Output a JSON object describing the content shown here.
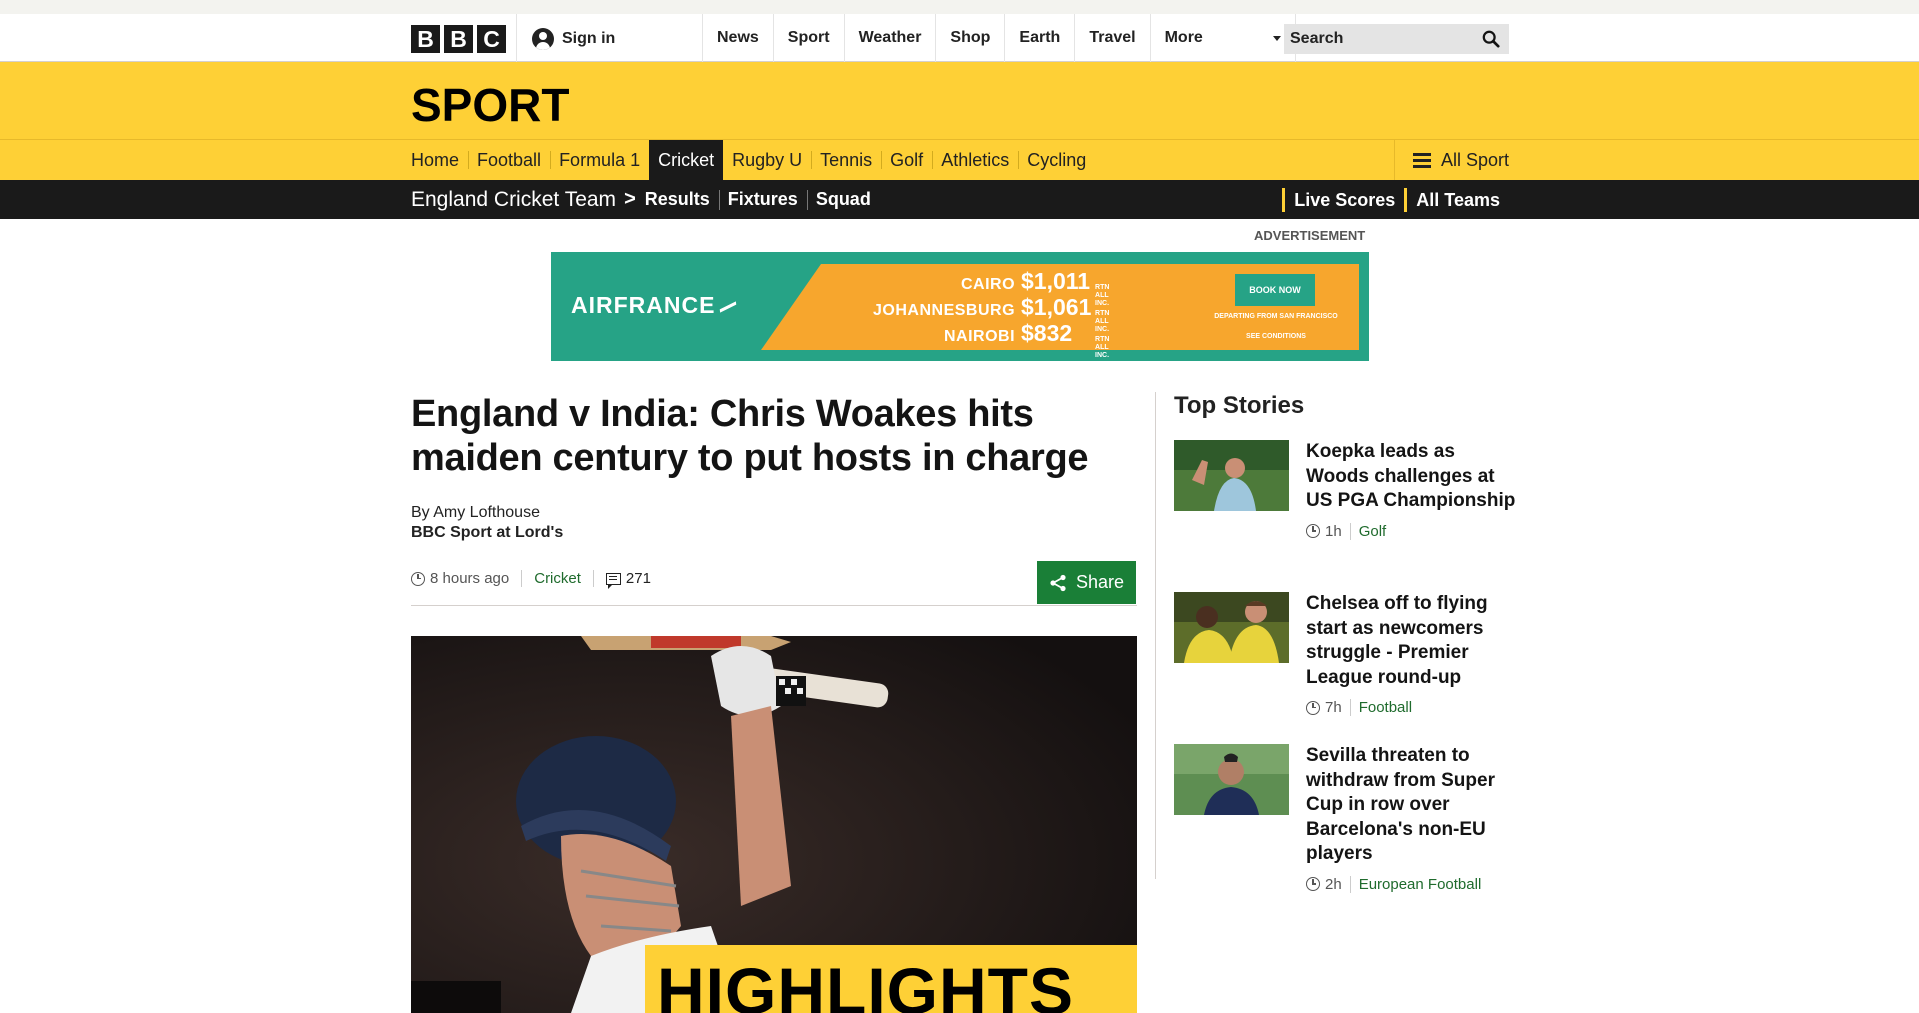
{
  "masthead": {
    "logo_letters": [
      "B",
      "B",
      "C"
    ],
    "signin_label": "Sign in",
    "nav": [
      "News",
      "Sport",
      "Weather",
      "Shop",
      "Earth",
      "Travel"
    ],
    "more_label": "More",
    "search_placeholder": "Search"
  },
  "sport": {
    "title": "SPORT",
    "nav": [
      "Home",
      "Football",
      "Formula 1",
      "Cricket",
      "Rugby U",
      "Tennis",
      "Golf",
      "Athletics",
      "Cycling"
    ],
    "active": "Cricket",
    "all_sport_label": "All Sport"
  },
  "subnav": {
    "team": "England Cricket Team",
    "separator": ">",
    "links": [
      "Results",
      "Fixtures",
      "Squad"
    ],
    "right_links": [
      "Live Scores",
      "All Teams"
    ]
  },
  "ad": {
    "label": "ADVERTISEMENT",
    "brand": "AIRFRANCE",
    "fares": [
      {
        "city": "CAIRO",
        "price": "$1,011",
        "note": "RTN ALL INC."
      },
      {
        "city": "JOHANNESBURG",
        "price": "$1,061",
        "note": "RTN ALL INC."
      },
      {
        "city": "NAIROBI",
        "price": "$832",
        "note": "RTN ALL INC."
      }
    ],
    "cta": "BOOK NOW",
    "departing": "DEPARTING FROM SAN FRANCISCO",
    "conditions": "SEE CONDITIONS"
  },
  "article": {
    "headline": "England v India: Chris Woakes hits maiden century to put hosts in charge",
    "author": "By Amy Lofthouse",
    "role": "BBC Sport at Lord's",
    "time": "8 hours ago",
    "category": "Cricket",
    "comments": "271",
    "share_label": "Share",
    "hero_overlay": "HIGHLIGHTS"
  },
  "sidebar": {
    "title": "Top Stories",
    "stories": [
      {
        "title": "Koepka leads as Woods challenges at US PGA Championship",
        "time": "1h",
        "category": "Golf"
      },
      {
        "title": "Chelsea off to flying start as newcomers struggle - Premier League round-up",
        "time": "7h",
        "category": "Football"
      },
      {
        "title": "Sevilla threaten to withdraw from Super Cup in row over Barcelona's non-EU players",
        "time": "2h",
        "category": "European Football"
      }
    ]
  },
  "colors": {
    "sport_yellow": "#fed036",
    "dark_nav": "#1a1a1a",
    "share_green": "#1a7f37",
    "category_green": "#1f6b2d",
    "ad_teal": "#26a386",
    "ad_orange": "#f7a62d"
  }
}
